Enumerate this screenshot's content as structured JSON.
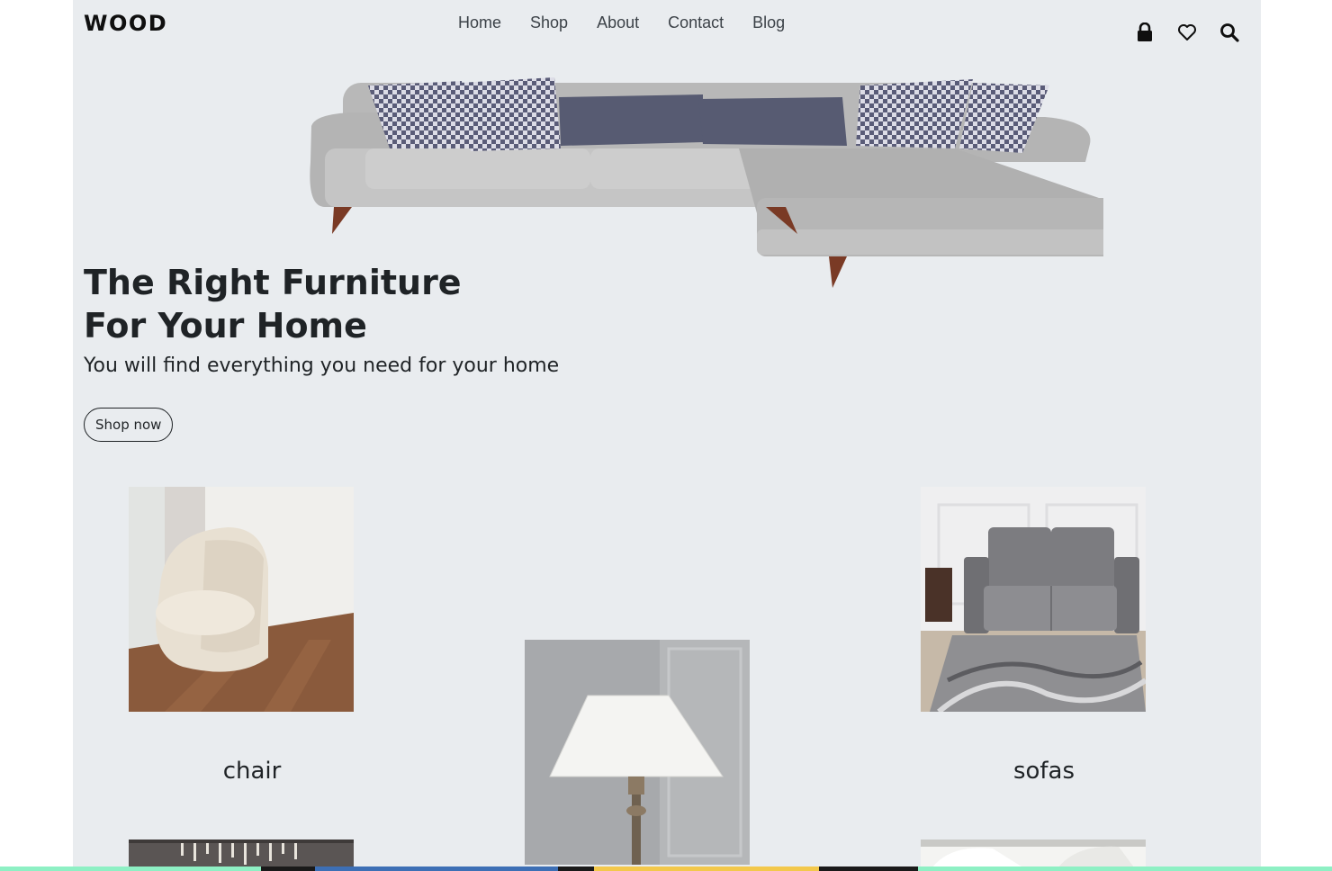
{
  "brand": {
    "logo": "WOOD"
  },
  "nav": {
    "items": [
      "Home",
      "Shop",
      "About",
      "Contact",
      "Blog"
    ]
  },
  "header_icons": [
    "lock-icon",
    "heart-icon",
    "search-icon"
  ],
  "hero": {
    "title_line1": "The Right Furniture",
    "title_line2": "For Your Home",
    "subtitle": "You will find everything you need for your home",
    "button": "Shop now"
  },
  "categories": [
    {
      "label": "chair"
    },
    {
      "label": ""
    },
    {
      "label": "sofas"
    }
  ],
  "colors": {
    "page_bg": "#e9ecef",
    "text": "#1f2326",
    "nav_text": "#3c4248"
  }
}
